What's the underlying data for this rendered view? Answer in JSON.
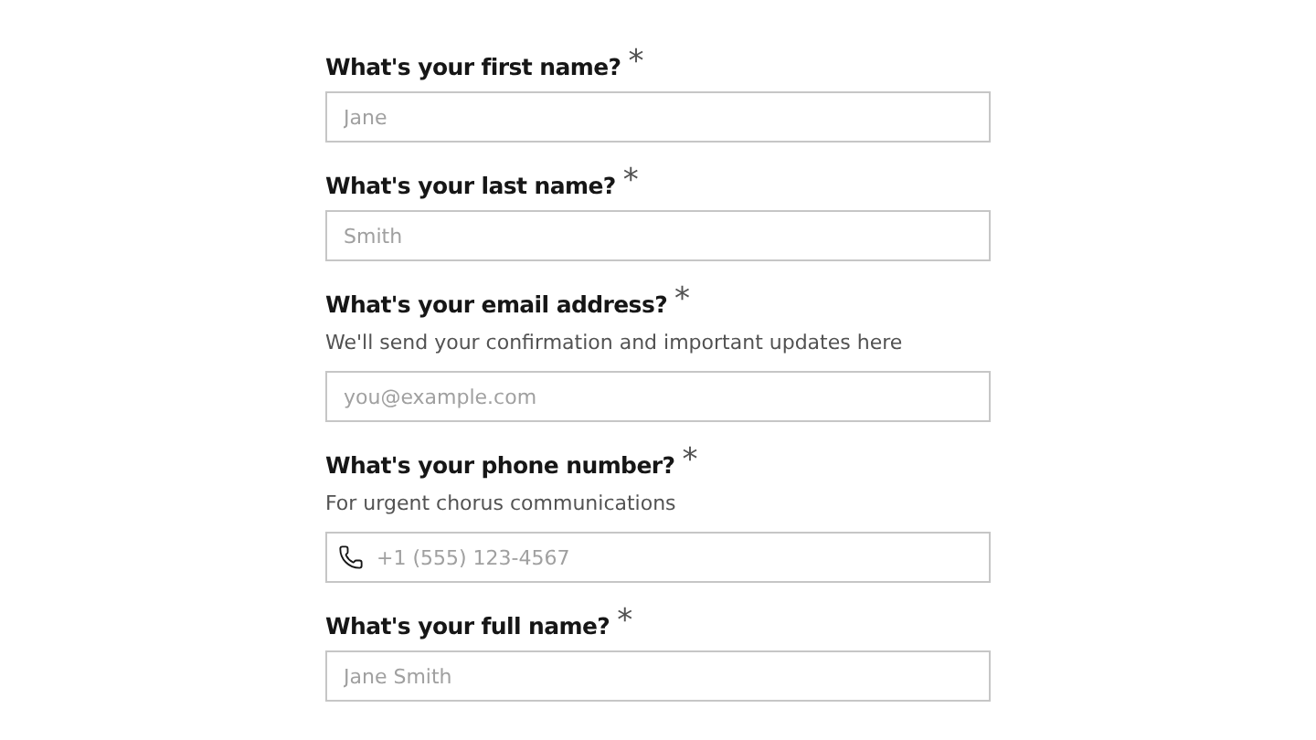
{
  "fields": [
    {
      "label": "What's your first name?",
      "mark": "*",
      "kind": "text",
      "placeholder": "Jane"
    },
    {
      "label": "What's your last name?",
      "mark": "*",
      "kind": "text",
      "placeholder": "Smith"
    },
    {
      "label": "What's your email address?",
      "mark": "*",
      "kind": "text",
      "hint": "We'll send your confirmation and important updates here",
      "placeholder": "you@example.com"
    },
    {
      "label": "What's your phone number?",
      "mark": "*",
      "kind": "phone",
      "hint": "For urgent chorus communications",
      "placeholder": "+1 (555) 123-4567"
    },
    {
      "label": "What's your full name?",
      "mark": "*",
      "kind": "text",
      "placeholder": "Jane Smith"
    }
  ]
}
